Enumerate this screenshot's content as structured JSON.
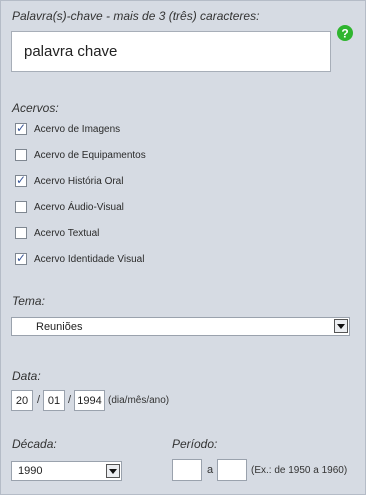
{
  "keyword": {
    "label": "Palavra(s)-chave - mais de 3 (três) caracteres:",
    "value": "palavra chave",
    "help_icon": "help-icon"
  },
  "acervos": {
    "label": "Acervos:",
    "items": [
      {
        "label": "Acervo de Imagens",
        "checked": true
      },
      {
        "label": "Acervo de Equipamentos",
        "checked": false
      },
      {
        "label": "Acervo História Oral",
        "checked": true
      },
      {
        "label": "Acervo Áudio-Visual",
        "checked": false
      },
      {
        "label": "Acervo Textual",
        "checked": false
      },
      {
        "label": "Acervo Identidade Visual",
        "checked": true
      }
    ]
  },
  "tema": {
    "label": "Tema:",
    "selected": "Reuniões"
  },
  "data": {
    "label": "Data:",
    "day": "20",
    "month": "01",
    "year": "1994",
    "sep1": "/",
    "sep2": "/",
    "hint": "(dia/mês/ano)"
  },
  "decada": {
    "label": "Década:",
    "selected": "1990"
  },
  "periodo": {
    "label": "Período:",
    "from": "",
    "to": "",
    "connector": "a",
    "hint": "(Ex.: de 1950 a 1960)"
  },
  "colors": {
    "panel": "#d6dbe3",
    "help": "#2fb52f",
    "check": "#3e5a9b"
  }
}
